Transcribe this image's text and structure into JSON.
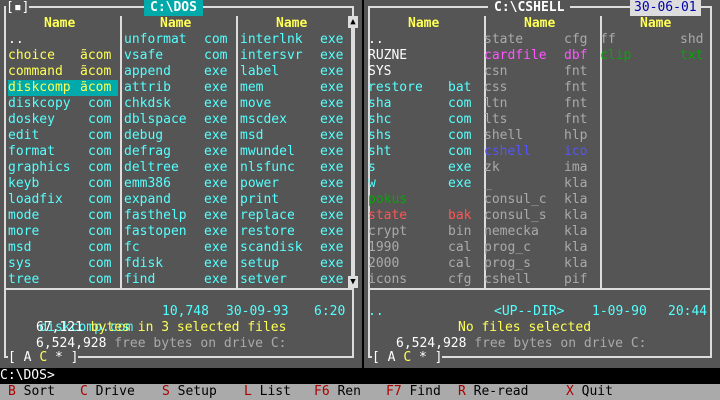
{
  "left": {
    "tag": "[▪]",
    "title": "C:\\DOS",
    "col_header": "Name",
    "cols": [
      [
        [
          "..",
          "",
          ""
        ],
        [
          "choice",
          "ãcom",
          "yellow"
        ],
        [
          "command",
          "ãcom",
          "yellow"
        ],
        [
          "diskcomp",
          "ãcom",
          "cursor"
        ],
        [
          "diskcopy",
          "com",
          "cyan"
        ],
        [
          "doskey",
          "com",
          "cyan"
        ],
        [
          "edit",
          "com",
          "cyan"
        ],
        [
          "format",
          "com",
          "cyan"
        ],
        [
          "graphics",
          "com",
          "cyan"
        ],
        [
          "keyb",
          "com",
          "cyan"
        ],
        [
          "loadfix",
          "com",
          "cyan"
        ],
        [
          "mode",
          "com",
          "cyan"
        ],
        [
          "more",
          "com",
          "cyan"
        ],
        [
          "msd",
          "com",
          "cyan"
        ],
        [
          "sys",
          "com",
          "cyan"
        ],
        [
          "tree",
          "com",
          "cyan"
        ]
      ],
      [
        [
          "unformat",
          "com",
          "cyan"
        ],
        [
          "vsafe",
          "com",
          "cyan"
        ],
        [
          "append",
          "exe",
          "cyan"
        ],
        [
          "attrib",
          "exe",
          "cyan"
        ],
        [
          "chkdsk",
          "exe",
          "cyan"
        ],
        [
          "dblspace",
          "exe",
          "cyan"
        ],
        [
          "debug",
          "exe",
          "cyan"
        ],
        [
          "defrag",
          "exe",
          "cyan"
        ],
        [
          "deltree",
          "exe",
          "cyan"
        ],
        [
          "emm386",
          "exe",
          "cyan"
        ],
        [
          "expand",
          "exe",
          "cyan"
        ],
        [
          "fasthelp",
          "exe",
          "cyan"
        ],
        [
          "fastopen",
          "exe",
          "cyan"
        ],
        [
          "fc",
          "exe",
          "cyan"
        ],
        [
          "fdisk",
          "exe",
          "cyan"
        ],
        [
          "find",
          "exe",
          "cyan"
        ]
      ],
      [
        [
          "interlnk",
          "exe",
          "cyan"
        ],
        [
          "intersvr",
          "exe",
          "cyan"
        ],
        [
          "label",
          "exe",
          "cyan"
        ],
        [
          "mem",
          "exe",
          "cyan"
        ],
        [
          "move",
          "exe",
          "cyan"
        ],
        [
          "mscdex",
          "exe",
          "cyan"
        ],
        [
          "msd",
          "exe",
          "cyan"
        ],
        [
          "mwundel",
          "exe",
          "cyan"
        ],
        [
          "nlsfunc",
          "exe",
          "cyan"
        ],
        [
          "power",
          "exe",
          "cyan"
        ],
        [
          "print",
          "exe",
          "cyan"
        ],
        [
          "replace",
          "exe",
          "cyan"
        ],
        [
          "restore",
          "exe",
          "cyan"
        ],
        [
          "scandisk",
          "exe",
          "cyan"
        ],
        [
          "setup",
          "exe",
          "cyan"
        ],
        [
          "setver",
          "exe",
          "cyan"
        ]
      ]
    ],
    "info_file": "diskcomp.com",
    "info_size": "10,748",
    "info_date": "30-09-93",
    "info_time": "6:20",
    "sel_count": "67,121",
    "sel_text": "bytes in 3 selected files",
    "free_bytes": "6,524,928",
    "free_text": "free bytes on drive C:",
    "drives_prefix": "[ ",
    "drive_a": "A",
    "drive_c": "C",
    "drive_star": "*",
    "drives_suffix": " ]"
  },
  "right": {
    "title": "C:\\CSHELL",
    "date": "30-06-01",
    "col_header": "Name",
    "cols": [
      [
        [
          "..",
          "",
          "white"
        ],
        [
          "RUZNE",
          "",
          "white"
        ],
        [
          "SYS",
          "",
          "white"
        ],
        [
          "restore",
          "bat",
          "cyan"
        ],
        [
          "sha",
          "com",
          "cyan"
        ],
        [
          "shc",
          "com",
          "cyan"
        ],
        [
          "shs",
          "com",
          "cyan"
        ],
        [
          "sht",
          "com",
          "cyan"
        ],
        [
          "s",
          "exe",
          "cyan"
        ],
        [
          "w",
          "exe",
          "cyan"
        ],
        [
          "pokus",
          "",
          "green"
        ],
        [
          "state",
          "bak",
          "red"
        ],
        [
          "crypt",
          "bin",
          "gray"
        ],
        [
          "1990",
          "cal",
          "gray"
        ],
        [
          "2000",
          "cal",
          "gray"
        ],
        [
          "icons",
          "cfg",
          "gray"
        ]
      ],
      [
        [
          "state",
          "cfg",
          "gray"
        ],
        [
          "cardfile",
          "dbf",
          "magenta"
        ],
        [
          "csn",
          "fnt",
          "gray"
        ],
        [
          "css",
          "fnt",
          "gray"
        ],
        [
          "ltn",
          "fnt",
          "gray"
        ],
        [
          "lts",
          "fnt",
          "gray"
        ],
        [
          "shell",
          "hlp",
          "gray"
        ],
        [
          "cshell",
          "ico",
          "blue"
        ],
        [
          "zk",
          "ima",
          "gray"
        ],
        [
          "_",
          "kla",
          "gray"
        ],
        [
          "consul_c",
          "kla",
          "gray"
        ],
        [
          "consul_s",
          "kla",
          "gray"
        ],
        [
          "nemecka",
          "kla",
          "gray"
        ],
        [
          "prog_c",
          "kla",
          "gray"
        ],
        [
          "prog_s",
          "kla",
          "gray"
        ],
        [
          "cshell",
          "pif",
          "gray"
        ]
      ],
      [
        [
          "ff",
          "shd",
          "gray"
        ],
        [
          "clip",
          "txt",
          "green"
        ]
      ]
    ],
    "info_file": "..",
    "info_dir": "<UP--DIR>",
    "info_date": "1-09-90",
    "info_time": "20:44",
    "sel_text": "No files selected",
    "free_bytes": "6,524,928",
    "free_text": "free bytes on drive C:",
    "drives_prefix": "[ ",
    "drive_a": "A",
    "drive_c": "C",
    "drive_star": "*",
    "drives_suffix": " ]"
  },
  "cmdline": "C:\\DOS>",
  "keybar": [
    {
      "key": "B",
      "label": "Sort"
    },
    {
      "key": "C",
      "label": "Drive"
    },
    {
      "key": "S",
      "label": "Setup"
    },
    {
      "key": "L",
      "label": "List"
    },
    {
      "key": "F6",
      "label": "Ren"
    },
    {
      "key": "F7",
      "label": "Find"
    },
    {
      "key": "R",
      "label": "Re-read"
    },
    {
      "key": "X",
      "label": "Quit"
    }
  ],
  "colors": {
    "panel_bg": "#555555",
    "accent": "#00aaaa",
    "cursor_text": "#ffff55"
  }
}
